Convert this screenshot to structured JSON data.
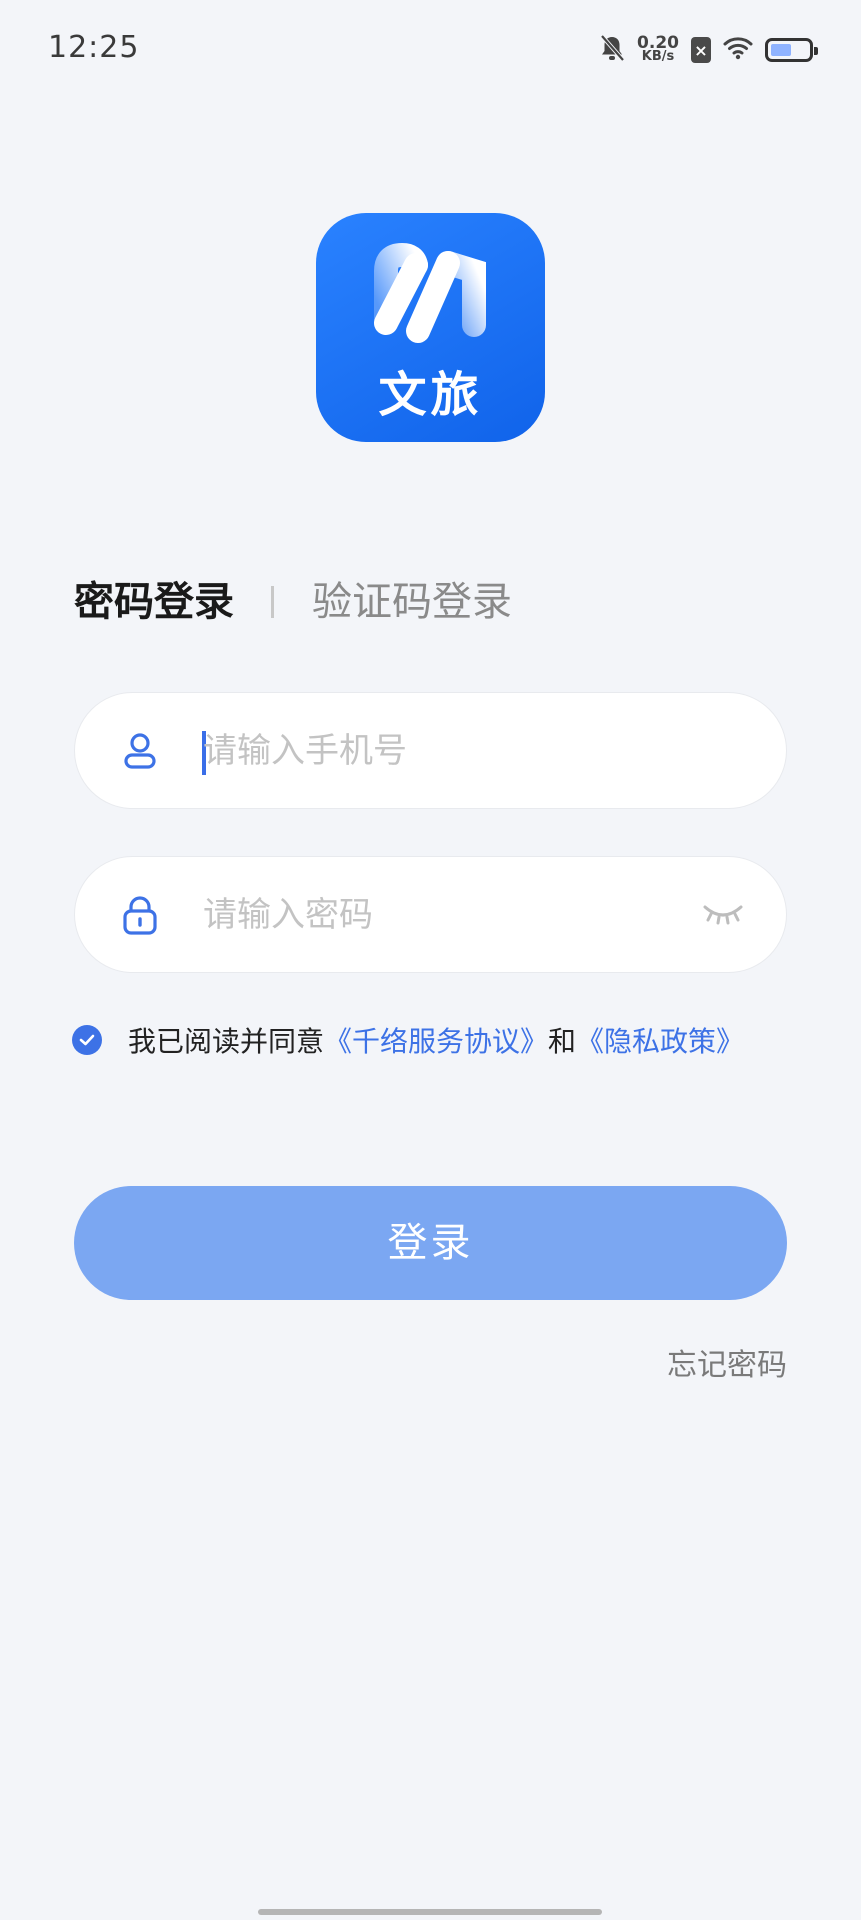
{
  "status_bar": {
    "time": "12:25",
    "net_speed": "0.20",
    "net_speed_unit": "KB/s",
    "icons": [
      "bell-muted-icon",
      "sim-disabled-icon",
      "wifi-icon",
      "battery-icon"
    ]
  },
  "logo": {
    "text": "文旅",
    "accent": "#1a6ff3"
  },
  "tabs": {
    "password_login": "密码登录",
    "code_login": "验证码登录"
  },
  "phone_input": {
    "placeholder": "请输入手机号",
    "value": ""
  },
  "password_input": {
    "placeholder": "请输入密码",
    "value": ""
  },
  "agreement": {
    "checked": true,
    "prefix": "我已阅读并同意",
    "service_link": "《千络服务协议》",
    "and": "和",
    "privacy_link": "《隐私政策》"
  },
  "login_button": {
    "label": "登录",
    "color": "#7ba7f2"
  },
  "forgot_password": "忘记密码",
  "colors": {
    "background": "#f3f5f9",
    "link": "#3d72e6",
    "inactive_tab": "#8a8a8a"
  }
}
